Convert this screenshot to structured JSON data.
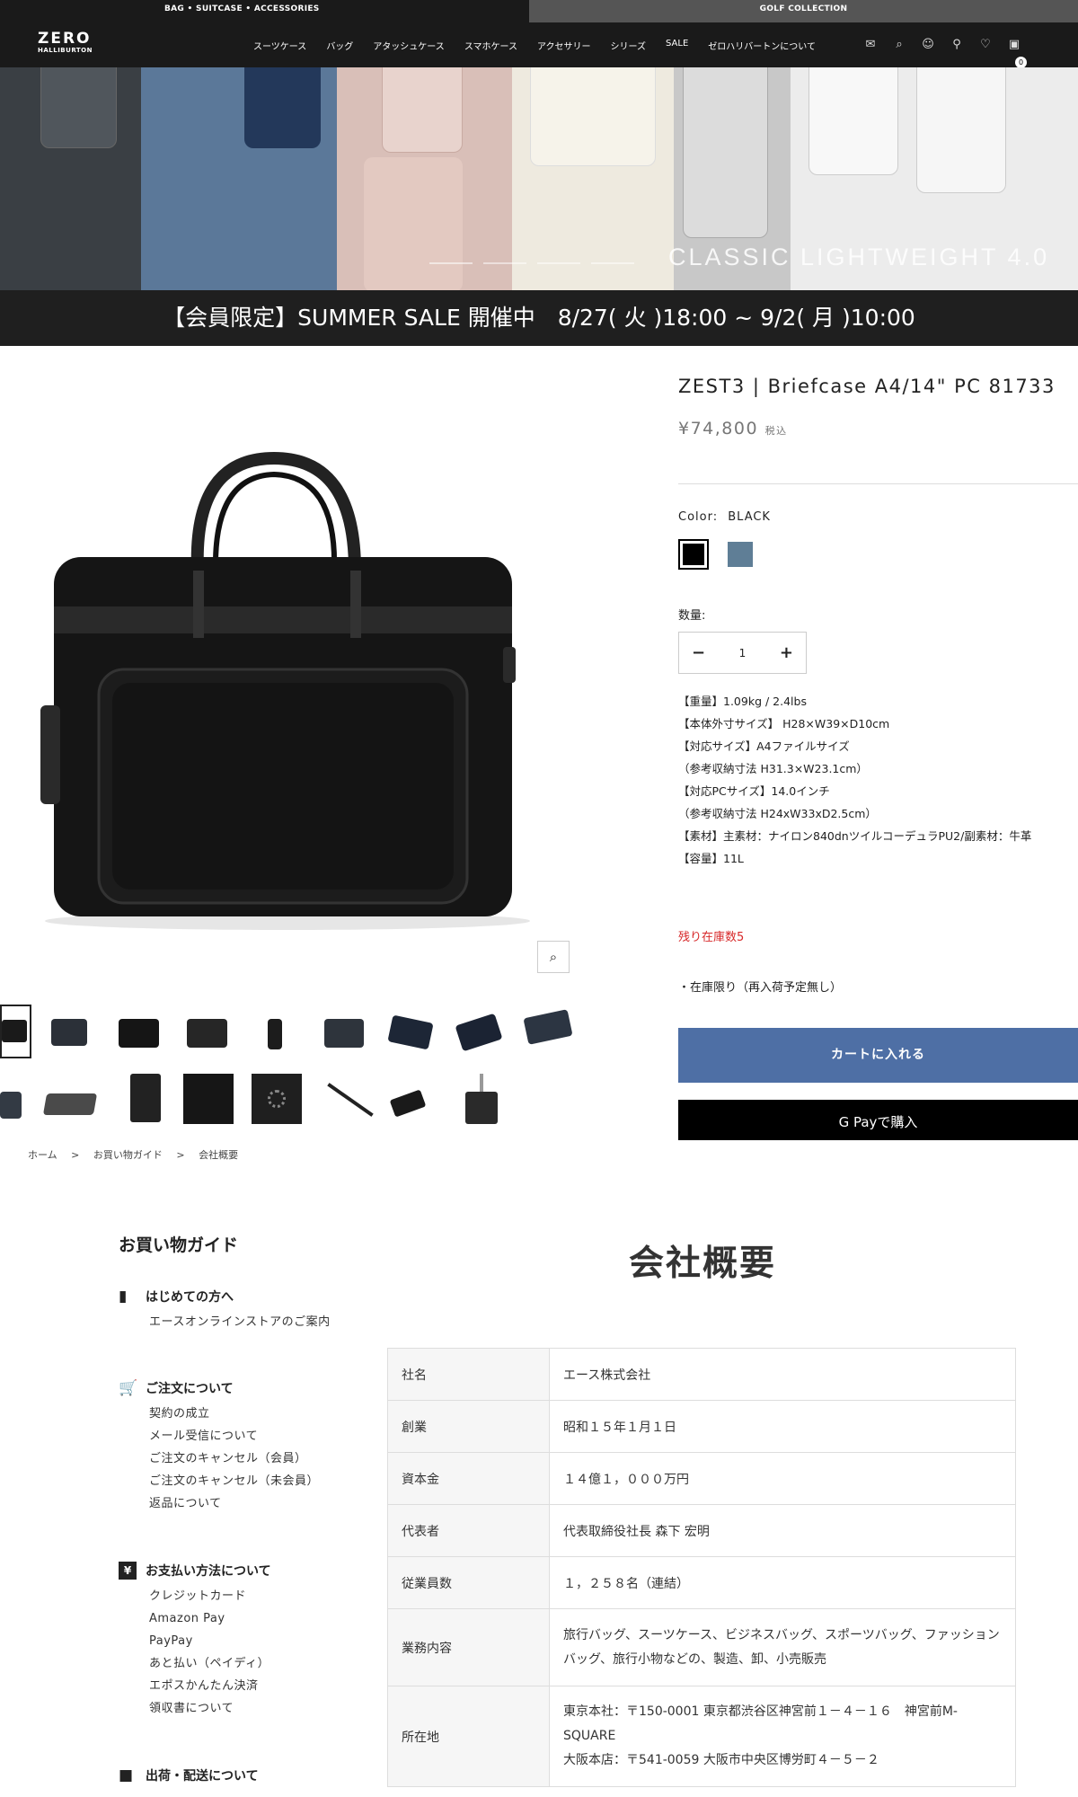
{
  "topbar": {
    "left": "BAG • SUITCASE • ACCESSORIES",
    "right": "GOLF COLLECTION"
  },
  "logo": {
    "line1": "ZERO",
    "line2": "HALLIBURTON"
  },
  "nav": [
    "スーツケース",
    "バッグ",
    "アタッシュケース",
    "スマホケース",
    "アクセサリー",
    "シリーズ",
    "SALE",
    "ゼロハリバートンについて"
  ],
  "header_icons": [
    "mail-icon",
    "search-icon",
    "account-icon",
    "location-icon",
    "heart-icon",
    "cart-icon"
  ],
  "cart_count": "0",
  "hero": {
    "title": "CLASSIC LIGHTWEIGHT 4.0",
    "slides": 4,
    "active_slide": 1
  },
  "banner": "【会員限定】SUMMER SALE 開催中　8/27( 火 )18:00 ~ 9/2( 月 )10:00",
  "product": {
    "title": "ZEST3 | Briefcase A4/14\" PC 81733",
    "price": "¥74,800",
    "tax_label": "税込",
    "color_label": "Color:",
    "color_value": "BLACK",
    "colors": [
      "#000000",
      "#5f7e96"
    ],
    "qty_label": "数量:",
    "qty_value": "1",
    "minus": "−",
    "plus": "+",
    "specs": [
      "【重量】1.09kg / 2.4lbs",
      "【本体外寸サイズ】 H28×W39×D10cm",
      "【対応サイズ】A4ファイルサイズ",
      "（参考収納寸法 H31.3×W23.1cm）",
      "【対応PCサイズ】14.0インチ",
      "（参考収納寸法 H24xW33xD2.5cm）",
      "【素材】主素材：ナイロン840dnツイルコーデュラPU2/副素材：牛革",
      "【容量】11L"
    ],
    "stock": "残り在庫数5",
    "stock_note": "・在庫限り（再入荷予定無し）",
    "add_to_cart": "カートに入れる",
    "gpay": "G Payで購入"
  },
  "breadcrumb": [
    "ホーム",
    ">",
    "お買い物ガイド",
    ">",
    "会社概要"
  ],
  "guide": {
    "title": "お買い物ガイド",
    "sections": [
      {
        "icon": "bookmark-icon",
        "glyph": "▮",
        "title": "はじめての方へ",
        "items": [
          "エースオンラインストアのご案内"
        ]
      },
      {
        "icon": "cart-icon",
        "glyph": "🛒",
        "title": "ご注文について",
        "items": [
          "契約の成立",
          "メール受信について",
          "ご注文のキャンセル（会員）",
          "ご注文のキャンセル（未会員）",
          "返品について"
        ]
      },
      {
        "icon": "yen-icon",
        "glyph": "¥",
        "title": "お支払い方法について",
        "items": [
          "クレジットカード",
          "Amazon Pay",
          "PayPay",
          "あと払い（ペイディ）",
          "エポスかんたん決済",
          "領収書について"
        ]
      },
      {
        "icon": "truck-icon",
        "glyph": "■",
        "title": "出荷・配送について",
        "items": []
      }
    ]
  },
  "company": {
    "title": "会社概要",
    "rows": [
      {
        "k": "社名",
        "v": "エース株式会社"
      },
      {
        "k": "創業",
        "v": "昭和１５年１月１日"
      },
      {
        "k": "資本金",
        "v": "１４億１，０００万円"
      },
      {
        "k": "代表者",
        "v": "代表取締役社長 森下 宏明"
      },
      {
        "k": "従業員数",
        "v": "１，２５８名（連結）"
      },
      {
        "k": "業務内容",
        "v": "旅行バッグ、スーツケース、ビジネスバッグ、スポーツバッグ、ファッションバッグ、旅行小物などの、製造、卸、小売販売"
      },
      {
        "k": "所在地",
        "v": "東京本社：〒150-0001 東京都渋谷区神宮前１－４－１６　神宮前M-SQUARE",
        "v2": "大阪本店：〒541-0059 大阪市中央区博労町４－５－２"
      }
    ]
  }
}
